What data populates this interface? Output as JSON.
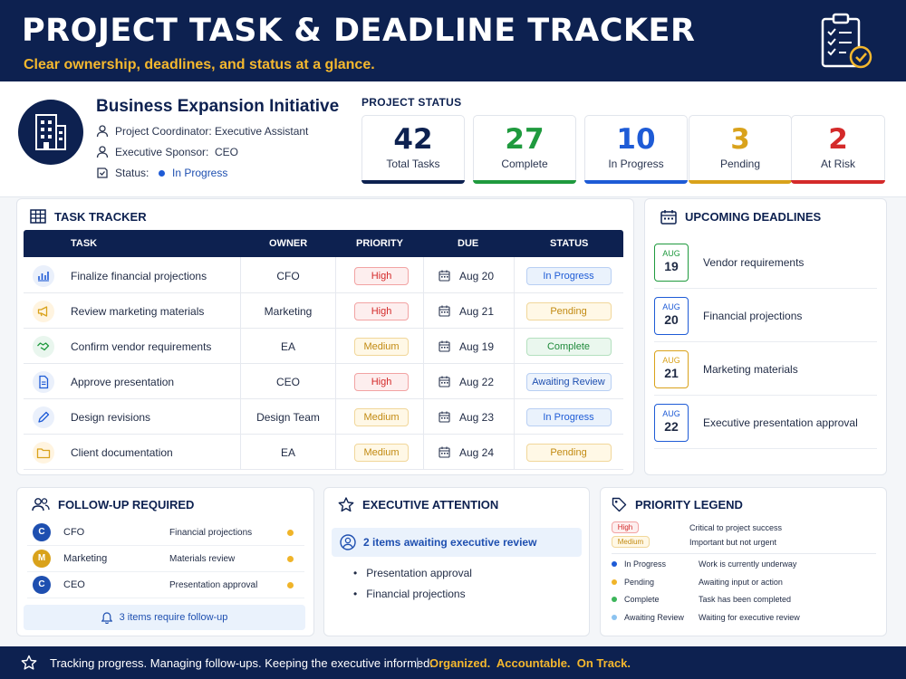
{
  "header": {
    "title": "PROJECT TASK & DEADLINE TRACKER",
    "subtitle": "Clear ownership, deadlines, and status at a glance.",
    "icon": "clipboard-check-icon"
  },
  "project": {
    "name": "Business Expansion Initiative",
    "coordinator_label": "Project Coordinator:",
    "coordinator_value": "Executive Assistant",
    "sponsor_label": "Executive Sponsor:",
    "sponsor_value": "CEO",
    "status_label": "Status:",
    "status_value": "In Progress"
  },
  "project_status": {
    "title": "PROJECT STATUS",
    "cards": [
      {
        "value": "42",
        "label": "Total Tasks",
        "color": "#0d2150"
      },
      {
        "value": "27",
        "label": "Complete",
        "color": "#1f9a3e"
      },
      {
        "value": "10",
        "label": "In Progress",
        "color": "#1e5bd6"
      },
      {
        "value": "3",
        "label": "Pending",
        "color": "#d9a21b"
      },
      {
        "value": "2",
        "label": "At Risk",
        "color": "#d42a2a"
      }
    ]
  },
  "task_tracker": {
    "title": "TASK TRACKER",
    "columns": [
      "TASK",
      "OWNER",
      "PRIORITY",
      "DUE",
      "STATUS"
    ],
    "rows": [
      {
        "icon": "bar-chart-icon",
        "task": "Finalize financial projections",
        "owner": "CFO",
        "priority": "High",
        "due": "Aug 20",
        "status": "In Progress"
      },
      {
        "icon": "megaphone-icon",
        "task": "Review marketing materials",
        "owner": "Marketing",
        "priority": "High",
        "due": "Aug 21",
        "status": "Pending"
      },
      {
        "icon": "handshake-icon",
        "task": "Confirm vendor requirements",
        "owner": "EA",
        "priority": "Medium",
        "due": "Aug 19",
        "status": "Complete"
      },
      {
        "icon": "document-icon",
        "task": "Approve presentation",
        "owner": "CEO",
        "priority": "High",
        "due": "Aug 22",
        "status": "Awaiting Review"
      },
      {
        "icon": "pencil-icon",
        "task": "Design revisions",
        "owner": "Design Team",
        "priority": "Medium",
        "due": "Aug 23",
        "status": "In Progress"
      },
      {
        "icon": "folder-icon",
        "task": "Client documentation",
        "owner": "EA",
        "priority": "Medium",
        "due": "Aug 24",
        "status": "Pending"
      }
    ]
  },
  "deadlines": {
    "title": "UPCOMING DEADLINES",
    "items": [
      {
        "month": "AUG",
        "day": "19",
        "text": "Vendor requirements",
        "color": "#1f9a3e"
      },
      {
        "month": "AUG",
        "day": "20",
        "text": "Financial projections",
        "color": "#1e5bd6"
      },
      {
        "month": "AUG",
        "day": "21",
        "text": "Marketing materials",
        "color": "#d9a21b"
      },
      {
        "month": "AUG",
        "day": "22",
        "text": "Executive presentation approval",
        "color": "#1e5bd6"
      }
    ]
  },
  "followup": {
    "title": "FOLLOW-UP REQUIRED",
    "rows": [
      {
        "initial": "C",
        "name": "CFO",
        "item": "Financial projections",
        "avatar_color": "#1e4fb0"
      },
      {
        "initial": "M",
        "name": "Marketing",
        "item": "Materials review",
        "avatar_color": "#d9a21b"
      },
      {
        "initial": "C",
        "name": "CEO",
        "item": "Presentation approval",
        "avatar_color": "#1e4fb0"
      }
    ],
    "footer": "3 items require follow-up"
  },
  "executive": {
    "title": "EXECUTIVE ATTENTION",
    "banner": "2 items awaiting executive review",
    "items": [
      "Presentation approval",
      "Financial projections"
    ]
  },
  "legend": {
    "title": "PRIORITY LEGEND",
    "priorities": [
      {
        "tag": "High",
        "desc": "Critical to project success"
      },
      {
        "tag": "Medium",
        "desc": "Important but not urgent"
      }
    ],
    "statuses": [
      {
        "name": "In Progress",
        "desc": "Work is currently underway",
        "color": "#1e5bd6"
      },
      {
        "name": "Pending",
        "desc": "Awaiting input or action",
        "color": "#f0b429"
      },
      {
        "name": "Complete",
        "desc": "Task has been completed",
        "color": "#3cb55a"
      },
      {
        "name": "Awaiting Review",
        "desc": "Waiting for executive review",
        "color": "#8cc3f0"
      }
    ]
  },
  "footer": {
    "text": "Tracking progress. Managing follow-ups. Keeping the executive informed.",
    "separator": "|",
    "tagline": "Organized.  Accountable.  On Track."
  }
}
